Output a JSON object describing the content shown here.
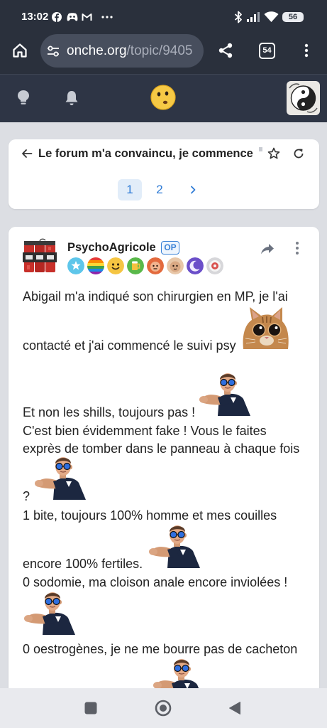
{
  "status_bar": {
    "time": "13:02",
    "battery": "56"
  },
  "browser": {
    "url_host": "onche.org",
    "url_path": "/topic/9405",
    "tab_count": "54"
  },
  "topic": {
    "title": "Le forum m'a convaincu, je commence",
    "pages": [
      "1",
      "2"
    ],
    "current_page": 1
  },
  "post": {
    "author": "PsychoAgricole",
    "author_tag": "OP",
    "badges": [
      "star-badge",
      "rainbow-badge",
      "smiley-badge",
      "beer-badge",
      "angry-face-badge",
      "neutral-face-badge",
      "moon-badge",
      "target-badge"
    ],
    "lines": [
      "Abigail m'a indiqué son chirurgien en MP, je l'ai",
      "contacté et j'ai commencé le suivi psy",
      "Et non les shills, toujours pas !",
      "C'est bien évidemment fake ! Vous le faites",
      "exprès de tomber dans le panneau à chaque fois",
      "?",
      "1 bite, toujours 100% homme et mes couilles",
      "encore 100% fertiles.",
      "0 sodomie, ma cloison anale encore inviolées !",
      "0 oestrogènes, je ne me bourre pas de cacheton"
    ]
  },
  "icons": {
    "status_left": [
      "facebook-icon",
      "game-controller-icon",
      "gmail-icon",
      "more-dots-icon"
    ],
    "status_right": [
      "bluetooth-icon",
      "signal-icon",
      "wifi-icon",
      "battery-icon"
    ],
    "toolbar": [
      "home-icon",
      "site-settings-icon",
      "share-icon",
      "tabs-icon",
      "menu-icon"
    ],
    "site_header": [
      "lightbulb-icon",
      "bell-icon",
      "smiley-logo-icon",
      "user-avatar"
    ],
    "topic_card": [
      "back-arrow-icon",
      "star-icon",
      "refresh-icon",
      "chevron-right-icon"
    ],
    "post_card": [
      "share-arrow-icon",
      "more-vert-icon"
    ],
    "bottom_nav": [
      "recents-square-icon",
      "home-circle-icon",
      "back-triangle-icon"
    ]
  },
  "colors": {
    "browser_bar": "#2a303c",
    "site_header": "#2e3545",
    "page_background": "#dcdee3",
    "card": "#ffffff",
    "accent": "#2e7bd6",
    "op_badge": "#3b82d6",
    "text": "#222222"
  }
}
